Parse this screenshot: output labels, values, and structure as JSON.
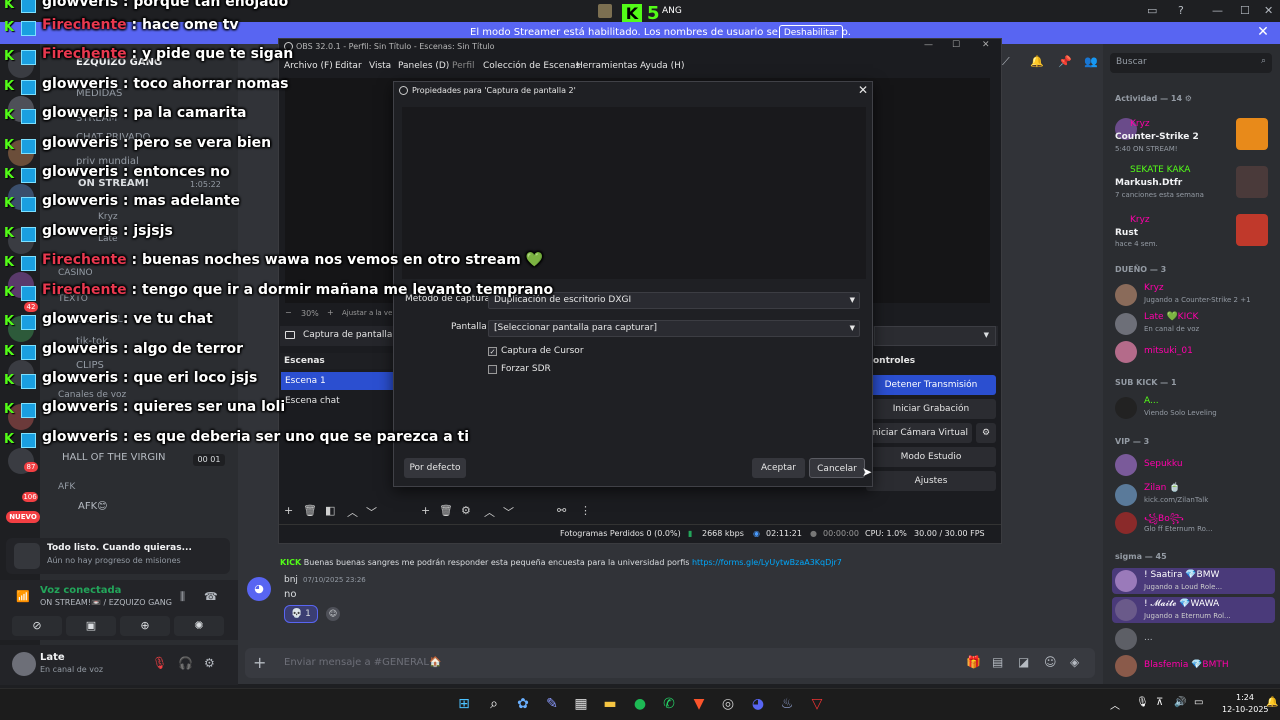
{
  "banner": {
    "text": "El modo Streamer está habilitado. Los nombres de usuario se han truncado.",
    "disable_label": "Deshabilitar",
    "close_icon": "✕"
  },
  "top_overlay": {
    "kick_letter": "K",
    "count": "5",
    "suffix": "ANG"
  },
  "window_controls": [
    "▭",
    "?",
    "—",
    "☐",
    "✕"
  ],
  "stream_chat": [
    {
      "user": "glowveris",
      "text": " : porque tan enojado",
      "color": "glow"
    },
    {
      "user": "Firechente",
      "text": " : hace ome tv",
      "color": "fire"
    },
    {
      "user": "Firechente",
      "text": " : y pide que te sigan",
      "color": "fire"
    },
    {
      "user": "glowveris",
      "text": " : toco ahorrar nomas",
      "color": "glow"
    },
    {
      "user": "glowveris",
      "text": " : pa la camarita",
      "color": "glow"
    },
    {
      "user": "glowveris",
      "text": " : pero se vera bien",
      "color": "glow"
    },
    {
      "user": "glowveris",
      "text": " : entonces no",
      "color": "glow"
    },
    {
      "user": "glowveris",
      "text": " : mas adelante",
      "color": "glow"
    },
    {
      "user": "glowveris",
      "text": " : jsjsjs",
      "color": "glow"
    },
    {
      "user": "Firechente",
      "text": " : buenas noches wawa nos vemos en otro stream 💚",
      "color": "fire"
    },
    {
      "user": "Firechente",
      "text": " : tengo que ir a dormir mañana me levanto temprano",
      "color": "fire"
    },
    {
      "user": "glowveris",
      "text": " : ve tu chat",
      "color": "glow"
    },
    {
      "user": "glowveris",
      "text": " : algo de terror",
      "color": "glow"
    },
    {
      "user": "glowveris",
      "text": " : que eri loco jsjs",
      "color": "glow"
    },
    {
      "user": "glowveris",
      "text": " : quieres ser una loli",
      "color": "glow"
    },
    {
      "user": "glowveris",
      "text": " : es que deberia ser uno que se parezca a ti",
      "color": "glow"
    }
  ],
  "channels": {
    "server_name": "EZQUIZO GANG",
    "items": [
      "MEDIDAS",
      "STREAM",
      "CHAT PRIVADO",
      "priv mundial",
      "ON STREAM!",
      "Kryz",
      "Late",
      "CASINO",
      "TEXTO",
      "GENERAL",
      "tik-tok",
      "CLIPS",
      "Canales de voz"
    ],
    "stream_time": "1:05:22",
    "hall": "HALL OF THE VIRGIN",
    "hall_count": "00 01",
    "afk_header": "AFK",
    "afk": "AFK😊",
    "nuevo": "NUEVO",
    "badge_87": "87",
    "badge_106": "106",
    "badge_42": "42"
  },
  "activity": {
    "title": "Todo listo. Cuando quieras...",
    "subtitle": "Aún no hay progreso de misiones"
  },
  "voice": {
    "status": "Voz conectada",
    "channel": "ON STREAM!📼 / EZQUIZO GANG"
  },
  "user": {
    "name": "Late",
    "status": "En canal de voz"
  },
  "obs": {
    "title": "OBS 32.0.1 - Perfil: Sin Título - Escenas: Sin Título",
    "menu": [
      "Archivo (F)",
      "Editar",
      "Vista",
      "Paneles (D)",
      "Perfil",
      "Colección de Escenas",
      "Herramientas",
      "Ayuda (H)"
    ],
    "zoom": "30%",
    "adjust": "Ajustar a la ve",
    "source": "Captura de pantalla 2",
    "scenes_title": "Escenas",
    "scenes": [
      "Escena 1",
      "Escena chat"
    ],
    "controls_title": "ontroles",
    "controls": [
      "Detener Transmisión",
      "Iniciar Grabación",
      "Iniciar Cámara Virtual",
      "Modo Estudio",
      "Ajustes"
    ],
    "status": {
      "dropped": "Fotogramas Perdidos 0 (0.0%)",
      "bitrate": "2668 kbps",
      "stream_time": "02:11:21",
      "rec_time": "00:00:00",
      "cpu": "CPU: 1.0%",
      "fps": "30.00 / 30.00 FPS"
    }
  },
  "dialog": {
    "title": "Propiedades para 'Captura de pantalla 2'",
    "method_label": "Método de captura",
    "method_value": "Duplicación de escritorio DXGI",
    "screen_label": "Pantalla",
    "screen_value": "[Seleccionar pantalla para capturar]",
    "capture_cursor": "Captura de Cursor",
    "force_sdr": "Forzar SDR",
    "defaults": "Por defecto",
    "accept": "Aceptar",
    "cancel": "Cancelar"
  },
  "chat_main": {
    "poster_tag": "KICK",
    "link_msg": "Buenas buenas sangres me podrán responder esta pequeña encuesta para la universidad porfis ",
    "link": "https://forms.gle/LyUytwBzaA3KqDjr7",
    "bnj_name": "bnj",
    "bnj_time": "07/10/2025 23:26",
    "bnj_msg": "no",
    "reaction": "💀 1",
    "input_placeholder": "Enviar mensaje a #GENERAL🏠"
  },
  "members": {
    "search_placeholder": "Buscar",
    "activity_header": "Actividad — 14 ⚙",
    "act": [
      {
        "name": "Kryz",
        "game": "Counter-Strike 2",
        "sub": "5:40 ON STREAM!"
      },
      {
        "name": "SEKATE KAKA",
        "game": "Markush.Dtfr",
        "sub": "7 canciones esta semana"
      },
      {
        "name": "Kryz",
        "game": "Rust",
        "sub": "hace 4 sem."
      }
    ],
    "owner_header": "DUEÑO — 3",
    "owners": [
      {
        "name": "Kryz",
        "sub": "Jugando a Counter-Strike 2 +1"
      },
      {
        "name": "Late 💚KICK",
        "sub": "En canal de voz"
      },
      {
        "name": "mitsuki_01",
        "sub": ""
      }
    ],
    "subkick_header": "SUB KICK — 1",
    "subkick": [
      {
        "name": "A...",
        "sub": "Viendo Solo Leveling"
      }
    ],
    "vip_header": "VIP — 3",
    "vips": [
      {
        "name": "Sepukku",
        "sub": ""
      },
      {
        "name": "Zilan 🍵",
        "sub": "kick.com/ZilanTalk"
      },
      {
        "name": "꧁Bo꧂",
        "sub": "Glo ff Eternum Ro..."
      }
    ],
    "sigma_header": "sigma — 45",
    "sigma": [
      {
        "name": "! Saatira 💎BMW",
        "sub": "Jugando a Loud Role..."
      },
      {
        "name": "! 𝓜𝓪𝓲𝓽𝓮 💎WAWA",
        "sub": "Jugando a Eternum Rol..."
      },
      {
        "name": "...",
        "sub": ""
      },
      {
        "name": "Blasfemia 💎BMTH",
        "sub": ""
      }
    ]
  },
  "taskbar": {
    "time": "1:24",
    "date": "12-10-2025"
  },
  "colors": {
    "discord_blurple": "#5865f2",
    "kick_green": "#53fc18",
    "obs_accent": "#2b4fd0",
    "fire_red": "#e8384f"
  }
}
